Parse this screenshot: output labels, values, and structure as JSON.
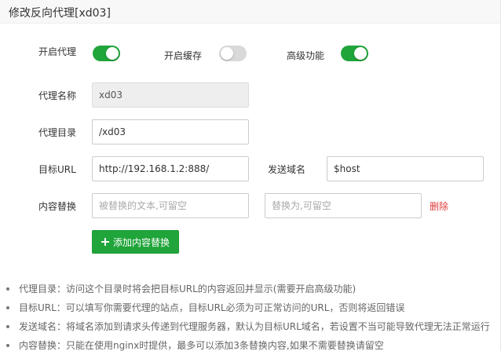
{
  "dialog": {
    "title": "修改反向代理[xd03]"
  },
  "toggles": {
    "proxy_label": "开启代理",
    "proxy_on": true,
    "cache_label": "开启缓存",
    "cache_on": false,
    "advanced_label": "高级功能",
    "advanced_on": true
  },
  "form": {
    "name_label": "代理名称",
    "name_value": "xd03",
    "dir_label": "代理目录",
    "dir_value": "/xd03",
    "target_label": "目标URL",
    "target_value": "http://192.168.1.2:888/",
    "domain_label": "发送域名",
    "domain_value": "$host",
    "replace_label": "内容替换",
    "replace_from_placeholder": "被替换的文本,可留空",
    "replace_to_placeholder": "替换为,可留空",
    "delete_label": "删除",
    "add_button_label": "添加内容替换"
  },
  "tips": [
    "代理目录：访问这个目录时将会把目标URL的内容返回并显示(需要开启高级功能)",
    "目标URL：可以填写你需要代理的站点，目标URL必须为可正常访问的URL，否则将返回错误",
    "发送域名：将域名添加到请求头传递到代理服务器，默认为目标URL域名，若设置不当可能导致代理无法正常运行",
    "内容替换：只能在使用nginx时提供，最多可以添加3条替换内容,如果不需要替换请留空"
  ],
  "colors": {
    "accent_green": "#20a53a",
    "toggle_off": "#d9d9d9",
    "danger_red": "#e23b3b"
  }
}
